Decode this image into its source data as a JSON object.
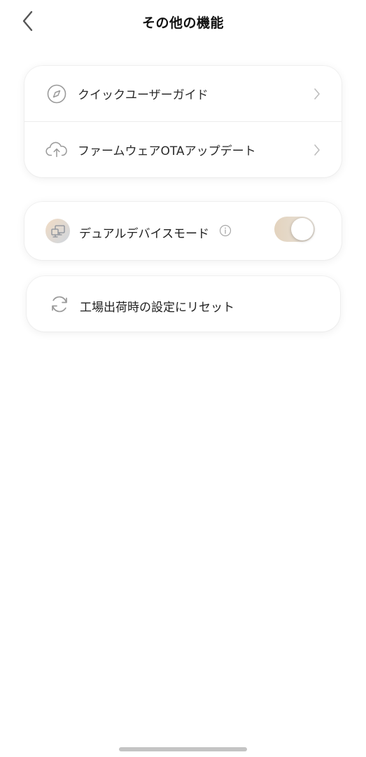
{
  "header": {
    "title": "その他の機能",
    "back_icon": "chevron-left-icon"
  },
  "card1": {
    "items": [
      {
        "label": "クイックユーザーガイド",
        "icon": "compass-icon"
      },
      {
        "label": "ファームウェアOTAアップデート",
        "icon": "cloud-upload-icon"
      }
    ]
  },
  "dual_device": {
    "label": "デュアルデバイスモード",
    "icon": "dual-monitor-icon",
    "info_icon": "info-icon",
    "toggle_on": true
  },
  "reset": {
    "label": "工場出荷時の設定にリセット",
    "icon": "refresh-icon"
  },
  "colors": {
    "background": "#ffffff",
    "text": "#222222",
    "chevron": "#bdbdbd",
    "toggle_track": "#e3d3be",
    "home_indicator": "#c4c4c4"
  }
}
